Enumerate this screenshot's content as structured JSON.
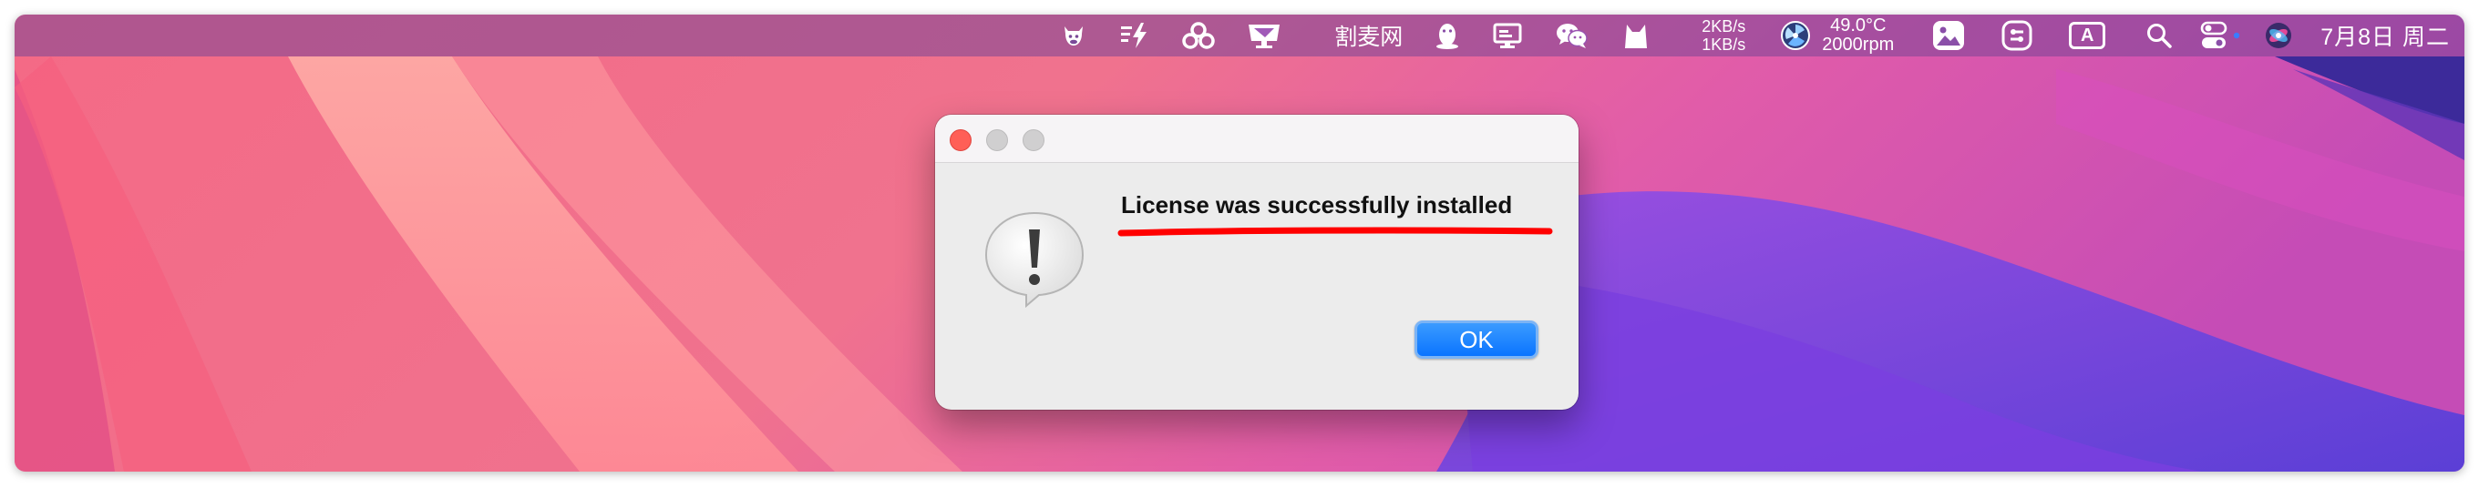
{
  "menubar": {
    "icons": [
      "cow-icon",
      "thunder-list-icon",
      "three-circles-icon",
      "display-icon"
    ],
    "app_name": "割麦网",
    "icons2": [
      "qq-penguin-icon",
      "monitor-icon",
      "wechat-icon",
      "cat-icon"
    ],
    "net_up": "2KB/s",
    "net_down": "1KB/s",
    "temperature": "49.0°C",
    "fan_speed": "2000rpm",
    "icons3": [
      "fan-icon",
      "photos-icon",
      "switch-icon",
      "keyboard-input-icon",
      "search-icon",
      "control-center-icon",
      "siri-icon"
    ],
    "input_method_label": "A",
    "date": "7月8日 周二"
  },
  "dialog": {
    "message": "License was successfully installed",
    "ok_label": "OK",
    "icon": "alert-caution-icon",
    "annotation_color": "#ff0000"
  },
  "colors": {
    "accent": "#0a74ff",
    "close": "#ff5f57"
  }
}
